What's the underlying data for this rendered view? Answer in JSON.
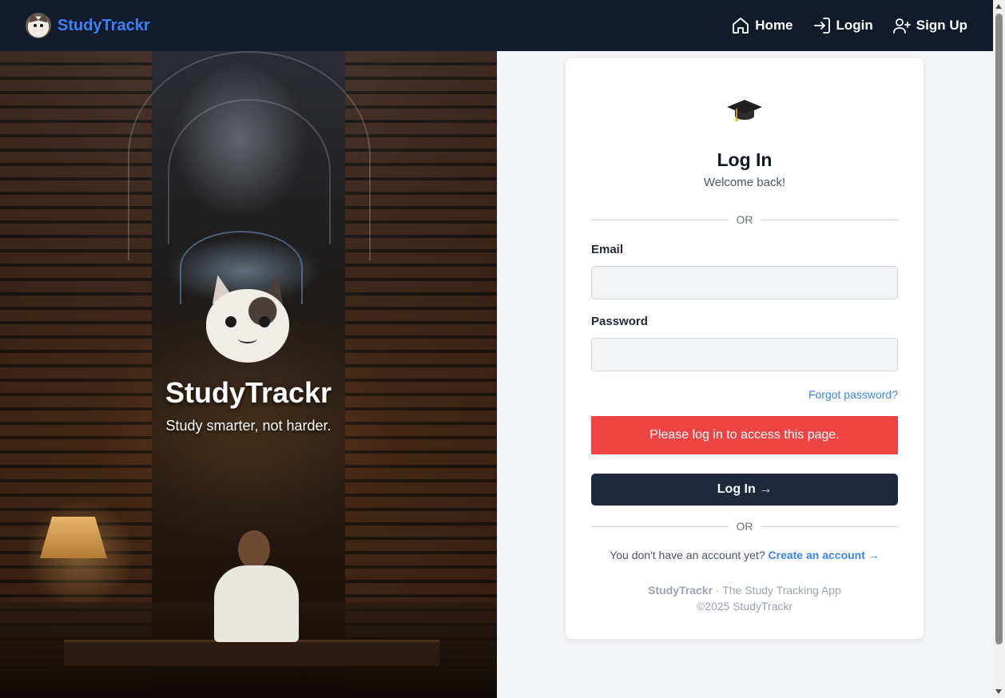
{
  "nav": {
    "brand": "StudyTrackr",
    "links": [
      {
        "label": "Home",
        "icon": "home-icon"
      },
      {
        "label": "Login",
        "icon": "login-icon"
      },
      {
        "label": "Sign Up",
        "icon": "user-plus-icon"
      }
    ]
  },
  "hero": {
    "title": "StudyTrackr",
    "tagline": "Study smarter, not harder."
  },
  "login": {
    "icon": "graduation-cap-icon",
    "title": "Log In",
    "subtitle": "Welcome back!",
    "divider_text": "OR",
    "email_label": "Email",
    "email_value": "",
    "password_label": "Password",
    "password_value": "",
    "forgot_link": "Forgot password?",
    "alert_message": "Please log in to access this page.",
    "submit_label": "Log In →",
    "divider_text_2": "OR",
    "no_account_text": "You don't have an account yet?",
    "create_account_link": "Create an account →",
    "footer_brand": "StudyTrackr",
    "footer_tagline": " · The Study Tracking App",
    "copyright": "©2025 StudyTrackr"
  },
  "colors": {
    "navbar_bg": "#121a2c",
    "brand": "#3b82f6",
    "alert": "#ef4444",
    "button": "#1e293b",
    "link": "#3b82f6"
  }
}
